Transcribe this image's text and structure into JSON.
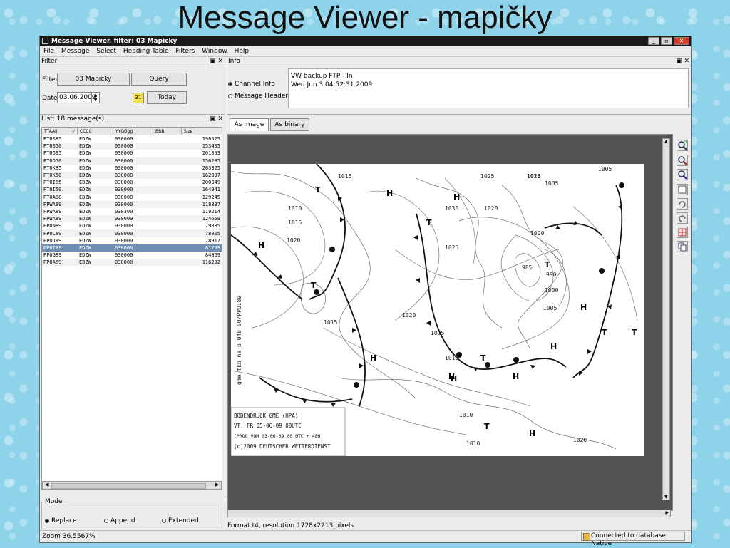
{
  "slide": {
    "title": "Message Viewer - mapičky"
  },
  "window": {
    "title": "Message Viewer, filter: 03 Mapicky",
    "controls": {
      "minimize": "_",
      "maximize": "▫",
      "close": "✕"
    }
  },
  "menu": [
    "File",
    "Message",
    "Select",
    "Heading Table",
    "Filters",
    "Window",
    "Help"
  ],
  "filter_panel": {
    "title": "Filter",
    "filter_label": "Filter",
    "filter_value": "03 Mapicky",
    "query_label": "Query",
    "date_label": "Date",
    "date_value": "03.06.2009",
    "calendar_icon_label": "31",
    "today_label": "Today"
  },
  "info_panel": {
    "title": "Info",
    "channel_info_label": "Channel Info",
    "message_header_label": "Message Header",
    "lines": [
      "VW backup FTP - In",
      "Wed Jun  3 04:52:31 2009"
    ]
  },
  "list_panel": {
    "title": "List: 18 message(s)",
    "columns": [
      "TTAAii",
      "CCCC",
      "YYGGgg",
      "BBB",
      "Size"
    ],
    "rows": [
      [
        "PTOS85",
        "EDZW",
        "030000",
        "",
        "190525"
      ],
      [
        "PTOS50",
        "EDZW",
        "030000",
        "",
        "153405"
      ],
      [
        "PTOO85",
        "EDZW",
        "030000",
        "",
        "201893"
      ],
      [
        "PTOO50",
        "EDZW",
        "030000",
        "",
        "156285"
      ],
      [
        "PTOK85",
        "EDZW",
        "030000",
        "",
        "203325"
      ],
      [
        "PTOK50",
        "EDZW",
        "030000",
        "",
        "162397"
      ],
      [
        "PTOI85",
        "EDZW",
        "030000",
        "",
        "200349"
      ],
      [
        "PTOI50",
        "EDZW",
        "030000",
        "",
        "164941"
      ],
      [
        "PTOA88",
        "EDZW",
        "030000",
        "",
        "129245"
      ],
      [
        "PPWA89",
        "EDZW",
        "030000",
        "",
        "118837"
      ],
      [
        "PPWA89",
        "EDZW",
        "030300",
        "",
        "119214"
      ],
      [
        "PPWA89",
        "EDZW",
        "030600",
        "",
        "124659"
      ],
      [
        "PPON89",
        "EDZW",
        "030000",
        "",
        "79885"
      ],
      [
        "PPOL89",
        "EDZW",
        "030000",
        "",
        "78005"
      ],
      [
        "PPOJ89",
        "EDZW",
        "030000",
        "",
        "78917"
      ],
      [
        "PPOI89",
        "EDZW",
        "030000",
        "",
        "81789"
      ],
      [
        "PPOG89",
        "EDZW",
        "030000",
        "",
        "84869"
      ],
      [
        "PPOA89",
        "EDZW",
        "030000",
        "",
        "116292"
      ]
    ],
    "selected_index": 15
  },
  "mode_panel": {
    "title": "Mode",
    "options": [
      "Replace",
      "Append",
      "Extended"
    ],
    "selected": 0
  },
  "viewer": {
    "tabs": [
      "As image",
      "As binary"
    ],
    "active_tab": 0,
    "format_text": "Format t4, resolution 1728x2213 pixels"
  },
  "map": {
    "side_label": "gme_tkb_na_p_048_00/PPOI89",
    "legend_lines": [
      "BODENDRUCK GME (HPA)",
      "VT: FR 05-06-09 00UTC",
      "(PROG VOM 03-06-09 00 UTC + 48H)",
      "(c)2009 DEUTSCHER WETTERDIENST"
    ],
    "isobar_labels": [
      "1015",
      "1010",
      "1015",
      "1020",
      "1025",
      "1015",
      "1020",
      "1030",
      "1025",
      "1020",
      "1025",
      "1010",
      "1005",
      "1005",
      "1000",
      "985",
      "990",
      "1000",
      "1005",
      "1015",
      "1010",
      "1010",
      "1010",
      "1020"
    ],
    "pressure_labels": [
      "T",
      "H",
      "H",
      "T",
      "H",
      "T",
      "T",
      "H",
      "H",
      "T",
      "T",
      "H",
      "T",
      "H",
      "H",
      "T",
      "H",
      "H"
    ]
  },
  "status": {
    "zoom": "Zoom 36.5567%",
    "db": "Connected to database: Native"
  }
}
